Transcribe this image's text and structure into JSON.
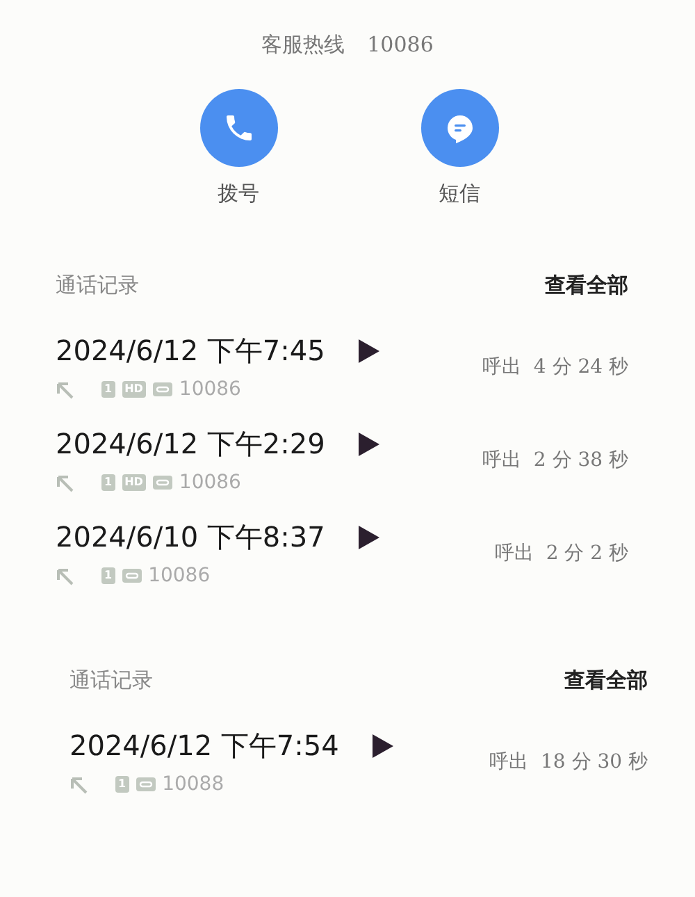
{
  "hotline": {
    "label": "客服热线",
    "number": "10086"
  },
  "actions": [
    {
      "kind": "phone",
      "label": "拨号"
    },
    {
      "kind": "message",
      "label": "短信"
    }
  ],
  "sections": [
    {
      "title": "通话记录",
      "link": "查看全部",
      "calls": [
        {
          "time": "2024/6/12 下午7:45",
          "sim": "1",
          "hd": "HD",
          "number": "10086",
          "direction": "呼出",
          "duration": "4 分 24 秒"
        },
        {
          "time": "2024/6/12 下午2:29",
          "sim": "1",
          "hd": "HD",
          "number": "10086",
          "direction": "呼出",
          "duration": "2 分 38 秒"
        },
        {
          "time": "2024/6/10 下午8:37",
          "sim": "1",
          "number": "10086",
          "direction": "呼出",
          "duration": "2 分 2 秒"
        }
      ]
    },
    {
      "title": "通话记录",
      "link": "查看全部",
      "calls": [
        {
          "time": "2024/6/12 下午7:54",
          "sim": "1",
          "number": "10088",
          "direction": "呼出",
          "duration": "18 分 30 秒"
        }
      ]
    }
  ]
}
